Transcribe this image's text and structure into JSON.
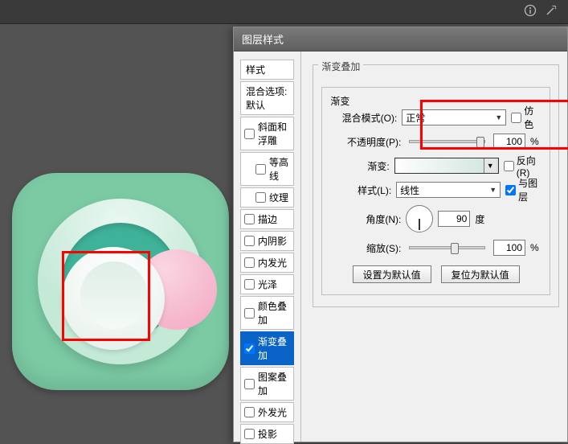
{
  "dialog": {
    "title": "图层样式",
    "styles_heading": "样式",
    "blend_defaults": "混合选项:默认",
    "items": [
      {
        "label": "斜面和浮雕",
        "checked": false
      },
      {
        "label": "等高线",
        "checked": false,
        "sub": true
      },
      {
        "label": "纹理",
        "checked": false,
        "sub": true
      },
      {
        "label": "描边",
        "checked": false
      },
      {
        "label": "内阴影",
        "checked": false
      },
      {
        "label": "内发光",
        "checked": false
      },
      {
        "label": "光泽",
        "checked": false
      },
      {
        "label": "颜色叠加",
        "checked": false
      },
      {
        "label": "渐变叠加",
        "checked": true,
        "selected": true
      },
      {
        "label": "图案叠加",
        "checked": false
      },
      {
        "label": "外发光",
        "checked": false
      },
      {
        "label": "投影",
        "checked": false
      }
    ]
  },
  "gradient_overlay": {
    "section_title": "渐变叠加",
    "grad_fieldset": "渐变",
    "blend_mode_label": "混合模式(O):",
    "blend_mode_value": "正常",
    "dither_label": "仿色",
    "opacity_label": "不透明度(P):",
    "opacity_value": "100",
    "pct": "%",
    "gradient_label": "渐变:",
    "reverse_label": "反向(R)",
    "style_label": "样式(L):",
    "style_value": "线性",
    "align_label": "与图层",
    "angle_label": "角度(N):",
    "angle_value": "90",
    "angle_unit": "度",
    "scale_label": "缩放(S):",
    "scale_value": "100",
    "set_default": "设置为默认值",
    "reset_default": "复位为默认值"
  }
}
